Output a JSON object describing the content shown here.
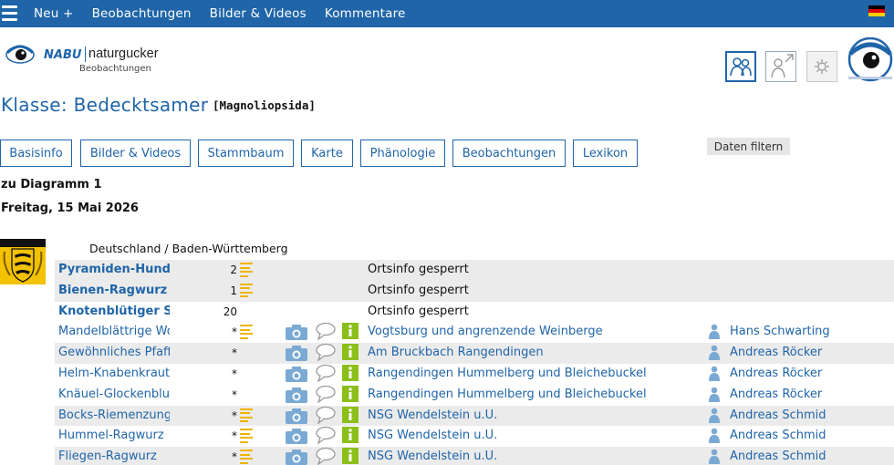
{
  "nav": {
    "items": [
      "Neu +",
      "Beobachtungen",
      "Bilder & Videos",
      "Kommentare"
    ],
    "language_flag": "flag-germany-icon"
  },
  "logo": {
    "brand": "NABU",
    "product": "naturgucker",
    "subtitle": "Beobachtungen"
  },
  "header": {
    "title": "Klasse: Bedecktsamer",
    "scientific": "[Magnoliopsida]"
  },
  "tabs": [
    "Basisinfo",
    "Bilder & Videos",
    "Stammbaum",
    "Karte",
    "Phänologie",
    "Beobachtungen",
    "Lexikon"
  ],
  "filter_label": "Daten filtern",
  "diagram_link": "zu Diagramm 1",
  "date": "Freitag, 15 Mai 2026",
  "location_heading": "Deutschland / Baden-Württemberg",
  "colors": {
    "brand_blue": "#1f65a8",
    "list_icon": "#f0b400",
    "camera_icon": "#7aaad4",
    "info_icon": "#8cbf1a",
    "row_shade": "#ebebeb"
  },
  "observations": [
    {
      "species": "Pyramiden-Hundswurz",
      "bold": true,
      "count": "2",
      "list": true,
      "media": false,
      "place": "Ortsinfo gesperrt",
      "locked": true,
      "observer": ""
    },
    {
      "species": "Bienen-Ragwurz",
      "bold": true,
      "count": "1",
      "list": true,
      "media": false,
      "place": "Ortsinfo gesperrt",
      "locked": true,
      "observer": ""
    },
    {
      "species": "Knotenblütiger Sellerie",
      "bold": true,
      "count": "20",
      "list": false,
      "media": false,
      "place": "Ortsinfo gesperrt",
      "locked": true,
      "observer": ""
    },
    {
      "species": "Mandelblättrige Wolfsmilch",
      "bold": false,
      "count": "*",
      "list": true,
      "media": true,
      "place": "Vogtsburg und angrenzende Weinberge",
      "locked": false,
      "observer": "Hans Schwarting"
    },
    {
      "species": "Gewöhnliches Pfaffenhütchen",
      "bold": false,
      "count": "*",
      "list": false,
      "media": true,
      "place": "Am Bruckbach Rangendingen",
      "locked": false,
      "observer": "Andreas Röcker"
    },
    {
      "species": "Helm-Knabenkraut",
      "bold": false,
      "count": "*",
      "list": false,
      "media": true,
      "place": "Rangendingen Hummelberg und Bleichebuckel",
      "locked": false,
      "observer": "Andreas Röcker"
    },
    {
      "species": "Knäuel-Glockenblume",
      "bold": false,
      "count": "*",
      "list": false,
      "media": true,
      "place": "Rangendingen Hummelberg und Bleichebuckel",
      "locked": false,
      "observer": "Andreas Röcker"
    },
    {
      "species": "Bocks-Riemenzunge",
      "bold": false,
      "count": "*",
      "list": true,
      "media": true,
      "place": "NSG Wendelstein u.U.",
      "locked": false,
      "observer": "Andreas Schmid"
    },
    {
      "species": "Hummel-Ragwurz",
      "bold": false,
      "count": "*",
      "list": true,
      "media": true,
      "place": "NSG Wendelstein u.U.",
      "locked": false,
      "observer": "Andreas Schmid"
    },
    {
      "species": "Fliegen-Ragwurz",
      "bold": false,
      "count": "*",
      "list": true,
      "media": true,
      "place": "NSG Wendelstein u.U.",
      "locked": false,
      "observer": "Andreas Schmid"
    }
  ]
}
